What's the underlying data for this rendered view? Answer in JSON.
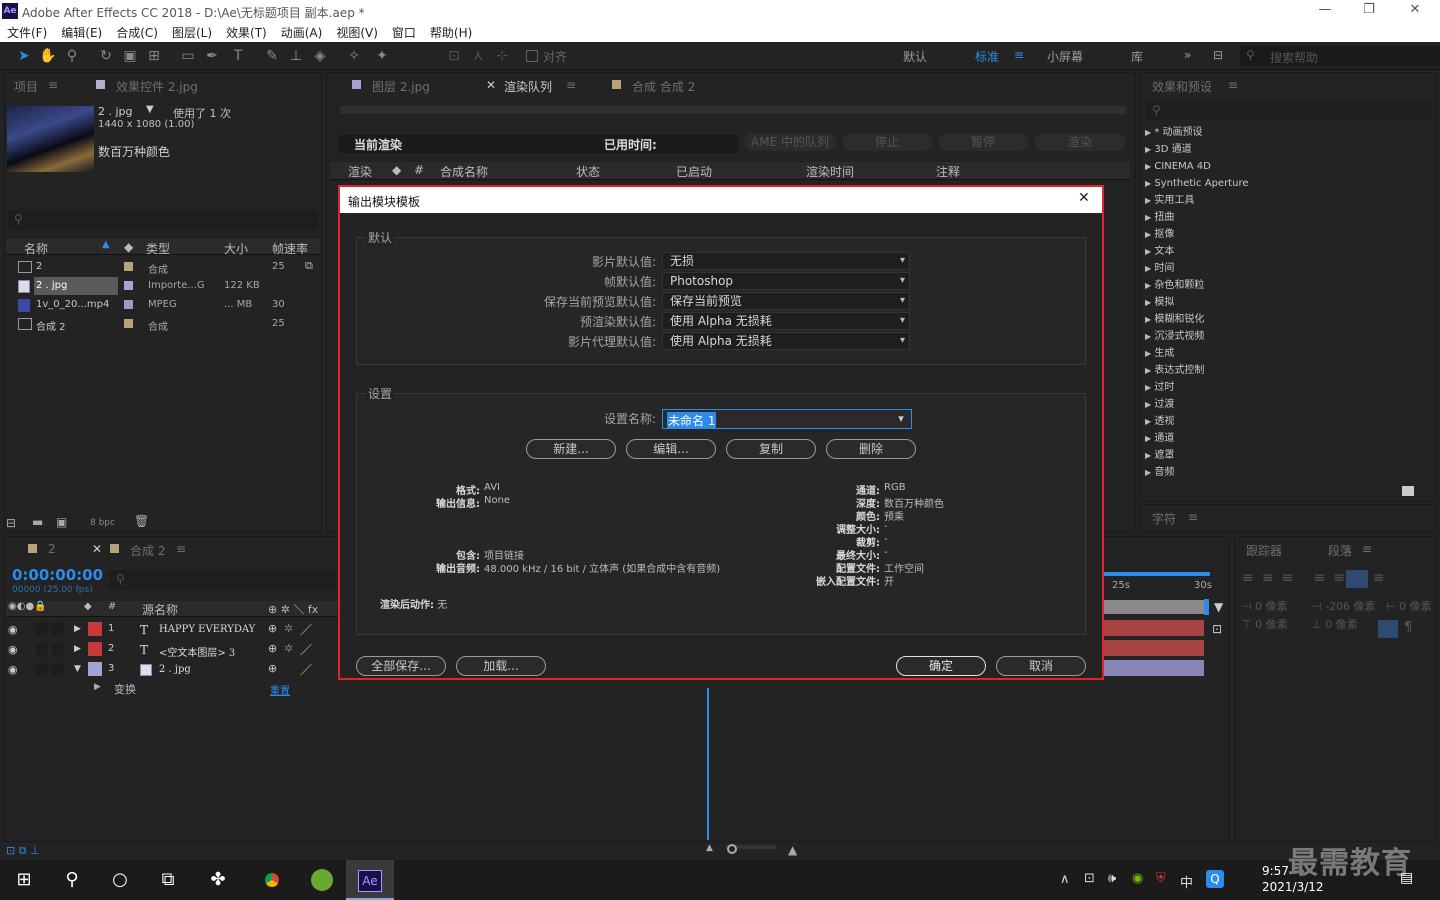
{
  "window": {
    "title": "Adobe After Effects CC 2018 - D:\\Ae\\无标题项目 副本.aep *",
    "icon": "Ae"
  },
  "menu": [
    "文件(F)",
    "编辑(E)",
    "合成(C)",
    "图层(L)",
    "效果(T)",
    "动画(A)",
    "视图(V)",
    "窗口",
    "帮助(H)"
  ],
  "toolbar": {
    "align_label": "对齐",
    "workspaces": [
      "默认",
      "标准",
      "小屏幕",
      "库"
    ],
    "active_workspace": "标准",
    "search_placeholder": "搜索帮助"
  },
  "project_panel": {
    "tab": "项目",
    "effects_tab": "效果控件 2.jpg",
    "selected_name": "2 . jpg",
    "used": "使用了 1 次",
    "dimensions": "1440 x 1080 (1.00)",
    "colors": "数百万种颜色",
    "columns": [
      "名称",
      "类型",
      "大小",
      "帧速率"
    ],
    "items": [
      {
        "name": "2",
        "type": "合成",
        "size": "",
        "fps": "25"
      },
      {
        "name": "2 . jpg",
        "type": "Importe...G",
        "size": "122 KB",
        "fps": ""
      },
      {
        "name": "1v_0_20...mp4",
        "type": "MPEG",
        "size": "... MB",
        "fps": "30"
      },
      {
        "name": "合成 2",
        "type": "合成",
        "size": "",
        "fps": "25"
      }
    ],
    "bpc": "8 bpc"
  },
  "center_tabs": [
    "图层 2.jpg",
    "渲染队列",
    "合成 合成 2"
  ],
  "render_queue": {
    "current_render": "当前渲染",
    "elapsed": "已用时间:",
    "buttons": [
      "AME 中的队列",
      "停止",
      "暂停",
      "渲染"
    ],
    "columns": [
      "渲染",
      "#",
      "合成名称",
      "状态",
      "已启动",
      "渲染时间",
      "注释"
    ]
  },
  "effects_panel": {
    "title": "效果和预设",
    "items": [
      "* 动画预设",
      "3D 通道",
      "CINEMA 4D",
      "Synthetic Aperture",
      "实用工具",
      "扭曲",
      "抠像",
      "文本",
      "时间",
      "杂色和颗粒",
      "模拟",
      "模糊和锐化",
      "沉浸式视频",
      "生成",
      "表达式控制",
      "过时",
      "过渡",
      "透视",
      "通道",
      "遮罩",
      "音频"
    ],
    "char_tab": "字符"
  },
  "timeline": {
    "tabs": [
      "2",
      "合成 2"
    ],
    "timecode": "0:00:00:00",
    "fps_info": "00000 (25.00 fps)",
    "col_name": "源名称",
    "layers": [
      {
        "num": "1",
        "type": "T",
        "name": "HAPPY EVERYDAY",
        "color": "#c83a3a"
      },
      {
        "num": "2",
        "type": "T",
        "name": "<空文本图层> 3",
        "color": "#c83a3a"
      },
      {
        "num": "3",
        "type": "img",
        "name": "2 . jpg",
        "color": "#a3a3d6"
      }
    ],
    "sub_row": "变换",
    "reset": "重置",
    "ruler": [
      "25s",
      "30s"
    ]
  },
  "right_bottom": {
    "tracker": "跟踪器",
    "paragraph": "段落",
    "vals": [
      "0 像素",
      "-206 像素",
      "0 像素",
      "0 像素",
      "0 像素"
    ]
  },
  "dialog": {
    "title": "输出模块模板",
    "defaults_group": "默认",
    "fields": [
      {
        "label": "影片默认值:",
        "value": "无损"
      },
      {
        "label": "帧默认值:",
        "value": "Photoshop"
      },
      {
        "label": "保存当前预览默认值:",
        "value": "保存当前预览"
      },
      {
        "label": "预渲染默认值:",
        "value": "使用 Alpha 无损耗"
      },
      {
        "label": "影片代理默认值:",
        "value": "使用 Alpha 无损耗"
      }
    ],
    "settings_group": "设置",
    "setting_name_label": "设置名称:",
    "setting_name_value": "未命名 1",
    "buttons": [
      "新建...",
      "编辑...",
      "复制",
      "删除"
    ],
    "info_left": [
      {
        "k": "格式:",
        "v": "AVI"
      },
      {
        "k": "输出信息:",
        "v": "None"
      },
      {
        "k": "包含:",
        "v": "项目链接"
      },
      {
        "k": "输出音频:",
        "v": "48.000 kHz / 16 bit / 立体声 (如果合成中含有音频)"
      }
    ],
    "info_right": [
      {
        "k": "通道:",
        "v": "RGB"
      },
      {
        "k": "深度:",
        "v": "数百万种颜色"
      },
      {
        "k": "颜色:",
        "v": "预乘"
      },
      {
        "k": "调整大小:",
        "v": "-"
      },
      {
        "k": "裁剪:",
        "v": "-"
      },
      {
        "k": "最终大小:",
        "v": "-"
      },
      {
        "k": "配置文件:",
        "v": "工作空间"
      },
      {
        "k": "嵌入配置文件:",
        "v": "开"
      }
    ],
    "post_render": {
      "k": "渲染后动作:",
      "v": "无"
    },
    "save_all": "全部保存...",
    "load": "加载...",
    "ok": "确定",
    "cancel": "取消"
  },
  "taskbar": {
    "time": "9:57",
    "date": "2021/3/12",
    "ime": "中",
    "watermark": "最需教育"
  },
  "colors": {
    "accent": "#2d8ceb",
    "dialog_border": "#e0252a",
    "label_red": "#c83a3a",
    "label_lavender": "#a3a3d6"
  }
}
